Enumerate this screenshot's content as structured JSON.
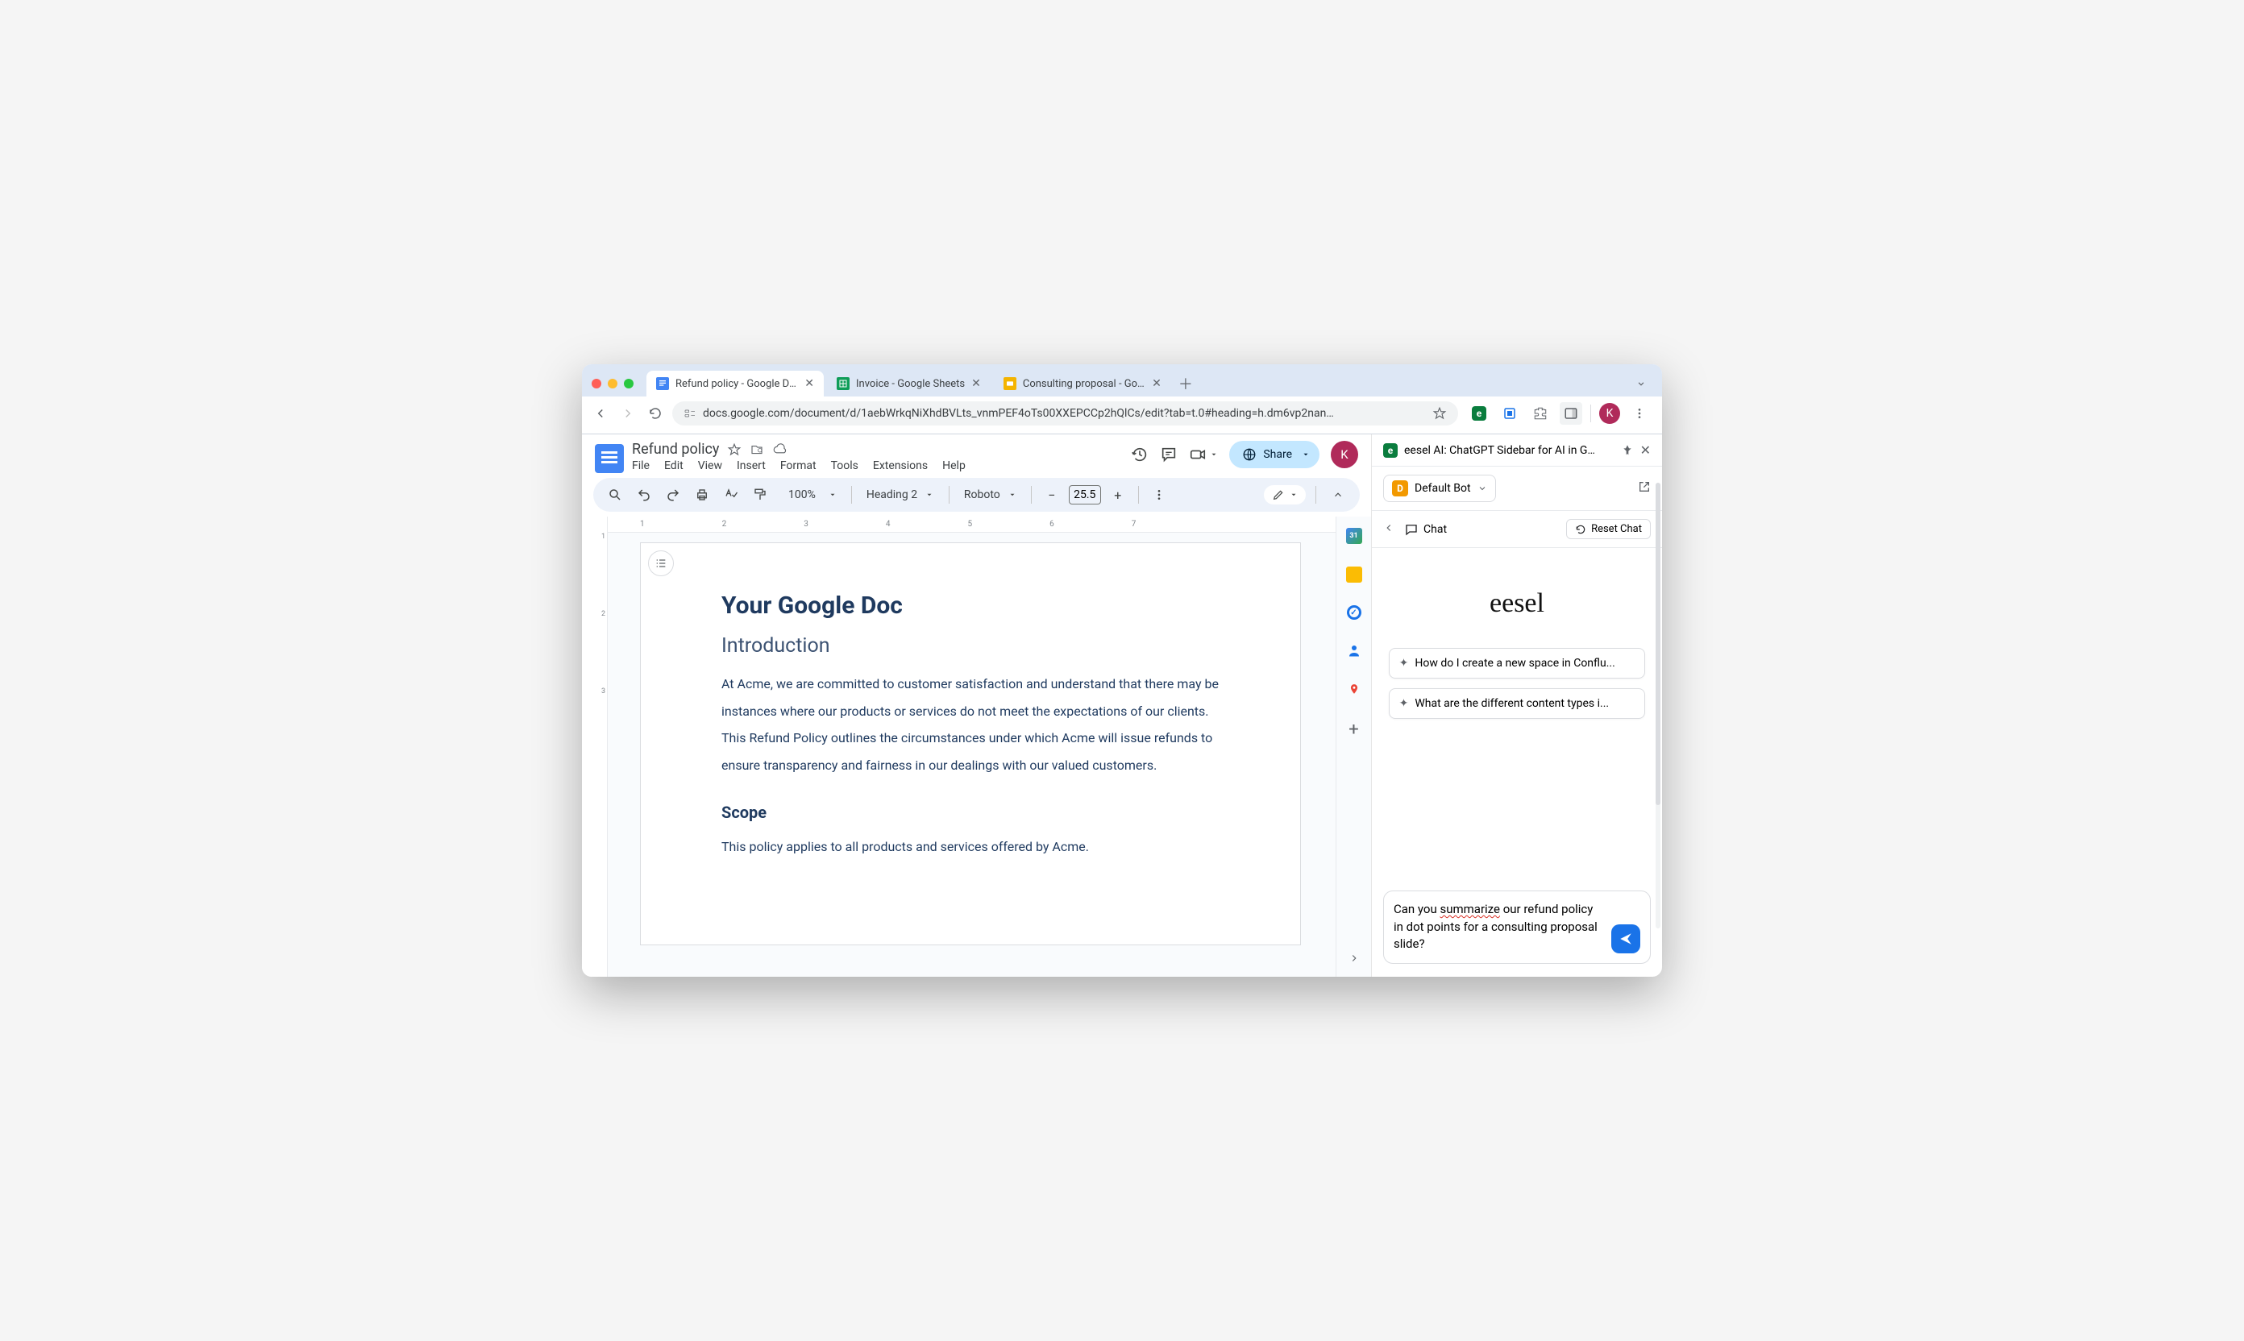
{
  "browser": {
    "tabs": [
      {
        "title": "Refund policy - Google Docs",
        "active": true
      },
      {
        "title": "Invoice - Google Sheets",
        "active": false
      },
      {
        "title": "Consulting proposal - Google…",
        "active": false
      }
    ],
    "url": "docs.google.com/document/d/1aebWrkqNiXhdBVLts_vnmPEF4oTs00XXEPCCp2hQlCs/edit?tab=t.0#heading=h.dm6vp2nan…",
    "avatar_initial": "K"
  },
  "docs": {
    "title": "Refund policy",
    "menus": [
      "File",
      "Edit",
      "View",
      "Insert",
      "Format",
      "Tools",
      "Extensions",
      "Help"
    ],
    "share_label": "Share",
    "avatar_initial": "K",
    "toolbar": {
      "zoom": "100%",
      "style": "Heading 2",
      "font": "Roboto",
      "font_size": "25.5"
    },
    "ruler_h": [
      "1",
      "2",
      "3",
      "4",
      "5",
      "6",
      "7"
    ],
    "ruler_v": [
      "1",
      "2",
      "3"
    ],
    "paper": {
      "h1": "Your Google Doc",
      "h2_intro": "Introduction",
      "p_intro": "At Acme, we are committed to customer satisfaction and understand that there may be instances where our products or services do not meet the expectations of our clients. This Refund Policy outlines the circumstances under which Acme will issue refunds to ensure transparency and fairness in our dealings with our valued customers.",
      "h3_scope": "Scope",
      "p_scope": "This policy applies to all products and services offered by Acme."
    }
  },
  "extension": {
    "header": "eesel AI: ChatGPT Sidebar for AI in G…",
    "bot_name": "Default Bot",
    "bot_initial": "D",
    "chat_label": "Chat",
    "reset_label": "Reset Chat",
    "brand": "eesel",
    "suggestions": [
      "How do I create a new space in Conflu...",
      "What are the different content types i..."
    ],
    "compose": {
      "part1": "Can you ",
      "underlined": "summarize",
      "part2": " our refund policy in dot points for a consulting proposal slide?"
    }
  }
}
